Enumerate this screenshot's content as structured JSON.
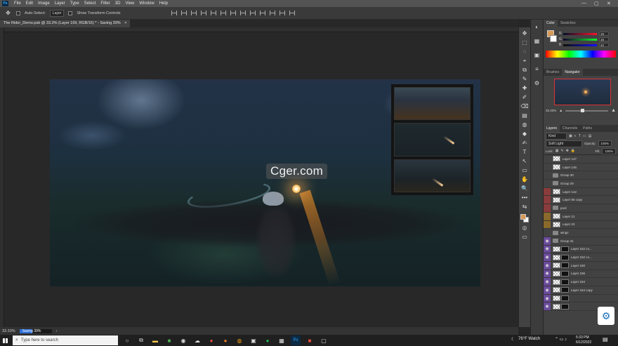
{
  "menubar": {
    "app_icon": "Ps",
    "items": [
      "File",
      "Edit",
      "Image",
      "Layer",
      "Type",
      "Select",
      "Filter",
      "3D",
      "View",
      "Window",
      "Help"
    ],
    "minimize": "—",
    "maximize": "▢",
    "close": "✕"
  },
  "options": {
    "auto_select_label": "Auto-Select:",
    "auto_select_value": "Layer",
    "transform_label": "Show Transform Controls"
  },
  "document": {
    "tab_title": "The Rider_Demo.psb @ 33.3% (Layer 169, RGB/16) * - Saving 39%",
    "tab_close": "×"
  },
  "watermark": "Cger.com",
  "status": {
    "zoom": "33.33%",
    "saving_label": "Saving 39%",
    "saving_progress": 0.39,
    "arrow": "›"
  },
  "tools": [
    "✥",
    "⬚",
    "◌",
    "⌖",
    "⧉",
    "✎",
    "✚",
    "✐",
    "⌫",
    "▤",
    "◍",
    "◆",
    "✍",
    "T",
    "↖",
    "▭",
    "✋",
    "🔍",
    "•••",
    "⇆"
  ],
  "minibar": [
    "◐",
    "▦",
    "▣",
    "≡",
    "⚙"
  ],
  "color_panel": {
    "tabs": [
      "Color",
      "Swatches"
    ],
    "rows": [
      {
        "label": "R",
        "value": "15"
      },
      {
        "label": "G",
        "value": "16"
      },
      {
        "label": "B",
        "value": "42"
      }
    ],
    "foreground": "#d99a55",
    "background": "#ffffff"
  },
  "navigator_panel": {
    "tabs": [
      "Brushes",
      "Navigator"
    ],
    "zoom": "33.33%"
  },
  "layers_panel": {
    "tabs": [
      "Layers",
      "Channels",
      "Paths"
    ],
    "filter_label": "Kind",
    "blend_mode": "Soft Light",
    "opacity_label": "Opacity:",
    "opacity_value": "100%",
    "lock_label": "Lock:",
    "fill_label": "Fill:",
    "fill_value": "100%",
    "layers": [
      {
        "name": "Layer 147",
        "visible": false,
        "color": "",
        "type": "layer"
      },
      {
        "name": "Layer 145",
        "visible": false,
        "color": "",
        "type": "layer"
      },
      {
        "name": "Group 30",
        "visible": false,
        "color": "",
        "type": "group"
      },
      {
        "name": "Group 29",
        "visible": false,
        "color": "",
        "type": "group"
      },
      {
        "name": "Layer 142",
        "visible": false,
        "color": "#8a3b3b",
        "type": "layer"
      },
      {
        "name": "Layer 56 copy",
        "visible": false,
        "color": "#8a3b3b",
        "type": "layer"
      },
      {
        "name": "pool",
        "visible": false,
        "color": "#8a3b3b",
        "type": "group"
      },
      {
        "name": "Layer 21",
        "visible": false,
        "color": "#8a6a2a",
        "type": "layer"
      },
      {
        "name": "Layer 22",
        "visible": false,
        "color": "#8a6a2a",
        "type": "layer"
      },
      {
        "name": "wings",
        "visible": false,
        "color": "",
        "type": "group"
      },
      {
        "name": "Group 31",
        "visible": true,
        "color": "#6a4a9a",
        "type": "group"
      },
      {
        "name": "Layer 162 co...",
        "visible": true,
        "color": "#6a4a9a",
        "type": "mask"
      },
      {
        "name": "Layer 162 co...",
        "visible": true,
        "color": "#6a4a9a",
        "type": "mask"
      },
      {
        "name": "Layer 160",
        "visible": true,
        "color": "#6a4a9a",
        "type": "mask"
      },
      {
        "name": "Layer 166",
        "visible": true,
        "color": "#6a4a9a",
        "type": "mask"
      },
      {
        "name": "Layer 164",
        "visible": true,
        "color": "#6a4a9a",
        "type": "mask"
      },
      {
        "name": "Layer 164 copy",
        "visible": true,
        "color": "#6a4a9a",
        "type": "mask"
      },
      {
        "name": "",
        "visible": true,
        "color": "#6a4a9a",
        "type": "mask"
      },
      {
        "name": "",
        "visible": true,
        "color": "#6a4a9a",
        "type": "mask"
      }
    ]
  },
  "taskbar": {
    "search_placeholder": "Type here to search",
    "weather": "76°F Watch",
    "time": "5:33 PM",
    "date": "6/12/2022"
  }
}
